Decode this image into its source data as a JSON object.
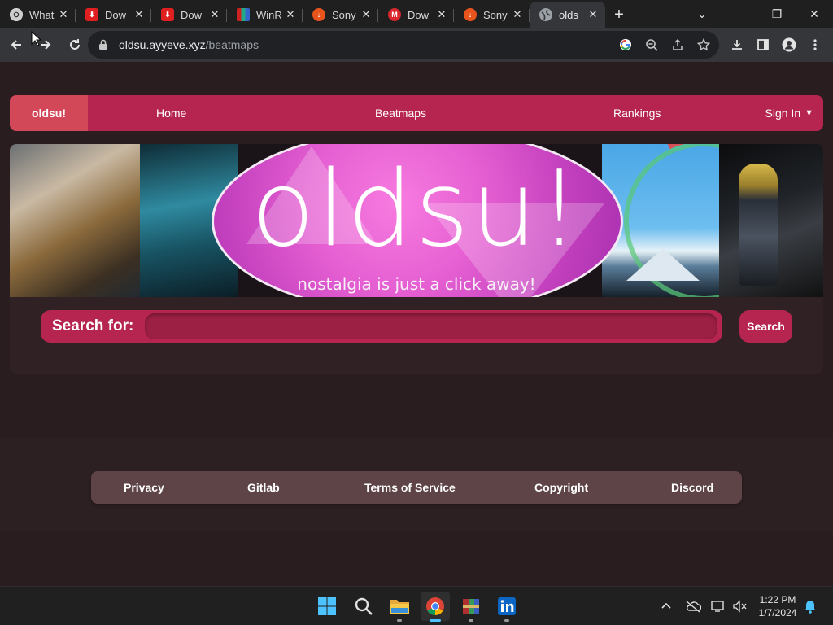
{
  "browser": {
    "tabs": [
      {
        "title": "What",
        "favicon": "chrome-icon",
        "color": "#e8eaed",
        "active": false
      },
      {
        "title": "Dow",
        "favicon": "download-site-icon",
        "color": "#e02020",
        "active": false
      },
      {
        "title": "Dow",
        "favicon": "download-site-icon",
        "color": "#e02020",
        "active": false
      },
      {
        "title": "WinR",
        "favicon": "winrar-icon",
        "color": "#7a3a8a",
        "active": false
      },
      {
        "title": "Sony",
        "favicon": "orange-download-icon",
        "color": "#e8541c",
        "active": false
      },
      {
        "title": "Dow",
        "favicon": "mega-icon",
        "color": "#d9272e",
        "active": false
      },
      {
        "title": "Sony",
        "favicon": "orange-download-icon",
        "color": "#e8541c",
        "active": false
      },
      {
        "title": "olds",
        "favicon": "globe-icon",
        "color": "#9aa0a6",
        "active": true
      }
    ],
    "close_glyph": "✕",
    "new_tab_glyph": "+",
    "window_controls": {
      "tab_search": "⌄",
      "minimize": "—",
      "restore": "❐",
      "close": "✕"
    },
    "address": {
      "host": "oldsu.ayyeve.xyz",
      "path": "/beatmaps"
    }
  },
  "site": {
    "brand_short": "oldsu!",
    "nav": {
      "home": "Home",
      "beatmaps": "Beatmaps",
      "rankings": "Rankings",
      "signin": "Sign In",
      "signin_caret": "▼"
    },
    "banner": {
      "wordmark": "oldsu!",
      "tagline": "nostalgia is just a click away!"
    },
    "search": {
      "label": "Search for:",
      "value": "",
      "placeholder": "",
      "button": "Search"
    },
    "footer": {
      "privacy": "Privacy",
      "gitlab": "Gitlab",
      "tos": "Terms of Service",
      "copyright": "Copyright",
      "discord": "Discord"
    },
    "colors": {
      "accent": "#b52550",
      "brand_block": "#d24858",
      "page_bg": "#2a1d20",
      "footer_bar": "#5e4446"
    }
  },
  "taskbar": {
    "apps": [
      "windows-start-icon",
      "search-icon",
      "file-explorer-icon",
      "chrome-icon",
      "winrar-icon",
      "linkedin-icon"
    ],
    "time": "1:22 PM",
    "date": "1/7/2024"
  }
}
